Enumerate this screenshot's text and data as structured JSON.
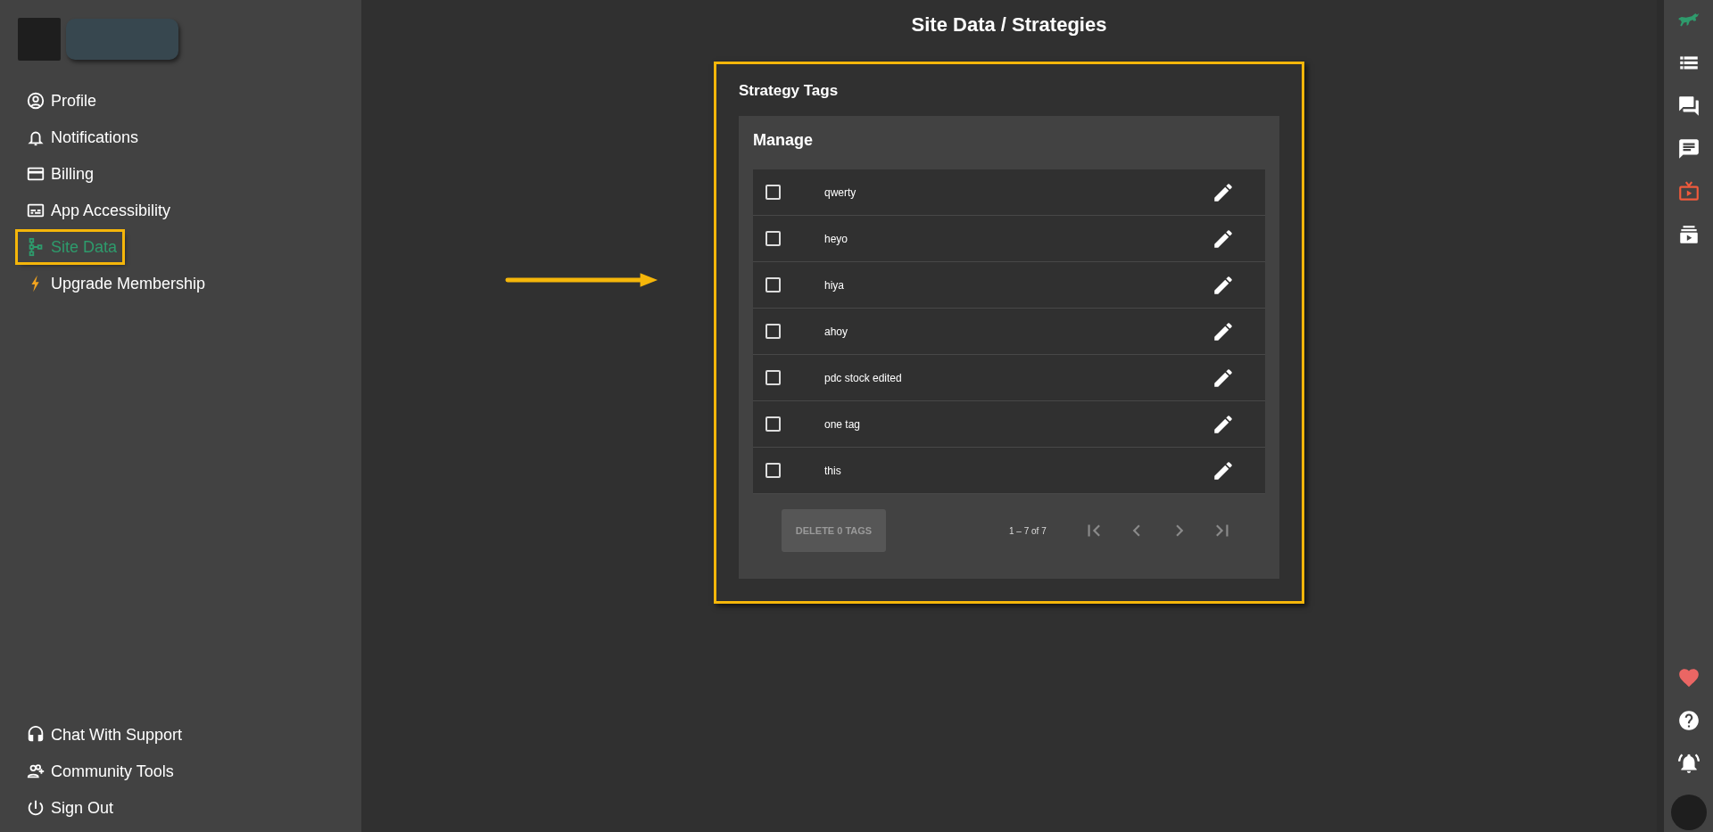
{
  "page_title": "Site Data / Strategies",
  "sidebar": {
    "items": [
      {
        "label": "Profile",
        "selected": false
      },
      {
        "label": "Notifications",
        "selected": false
      },
      {
        "label": "Billing",
        "selected": false
      },
      {
        "label": "App Accessibility",
        "selected": false
      },
      {
        "label": "Site Data",
        "selected": true
      },
      {
        "label": "Upgrade Membership",
        "selected": false
      }
    ],
    "footer_items": [
      {
        "label": "Chat With Support"
      },
      {
        "label": "Community Tools"
      },
      {
        "label": "Sign Out"
      }
    ]
  },
  "card": {
    "title": "Strategy Tags",
    "panel_title": "Manage",
    "rows": [
      {
        "name": "qwerty",
        "checked": false
      },
      {
        "name": "heyo",
        "checked": false
      },
      {
        "name": "hiya",
        "checked": false
      },
      {
        "name": "ahoy",
        "checked": false
      },
      {
        "name": "pdc stock edited",
        "checked": false
      },
      {
        "name": "one tag",
        "checked": false
      },
      {
        "name": "this",
        "checked": false
      }
    ],
    "delete_button": {
      "label": "DELETE 0 TAGS",
      "disabled": true
    },
    "range": "1 – 7 of 7",
    "pager": [
      {
        "kind": "first",
        "disabled": true
      },
      {
        "kind": "prev",
        "disabled": true
      },
      {
        "kind": "next",
        "disabled": true
      },
      {
        "kind": "last",
        "disabled": true
      }
    ]
  }
}
